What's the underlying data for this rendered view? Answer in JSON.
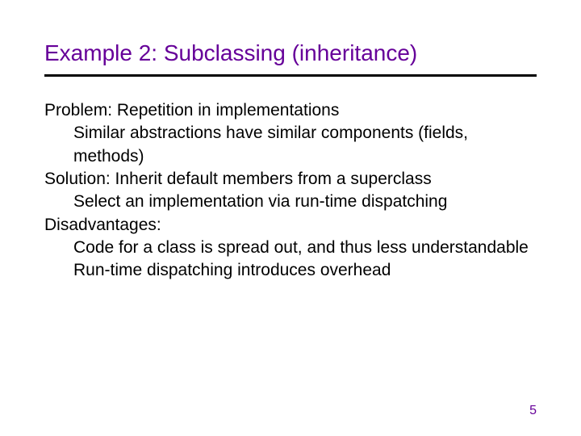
{
  "title": "Example 2:  Subclassing (inheritance)",
  "body": {
    "problem_label": "Problem:  Repetition in implementations",
    "problem_detail": "Similar abstractions have similar components (fields, methods)",
    "solution_label": "Solution:  Inherit default members from a superclass",
    "solution_detail": "Select an implementation via run-time dispatching",
    "disadv_label": "Disadvantages:",
    "disadv_1": "Code for a class is spread out, and thus less understandable",
    "disadv_2": " Run-time dispatching introduces overhead"
  },
  "page_number": "5",
  "colors": {
    "accent": "#660099",
    "text": "#000000",
    "rule": "#000000"
  }
}
